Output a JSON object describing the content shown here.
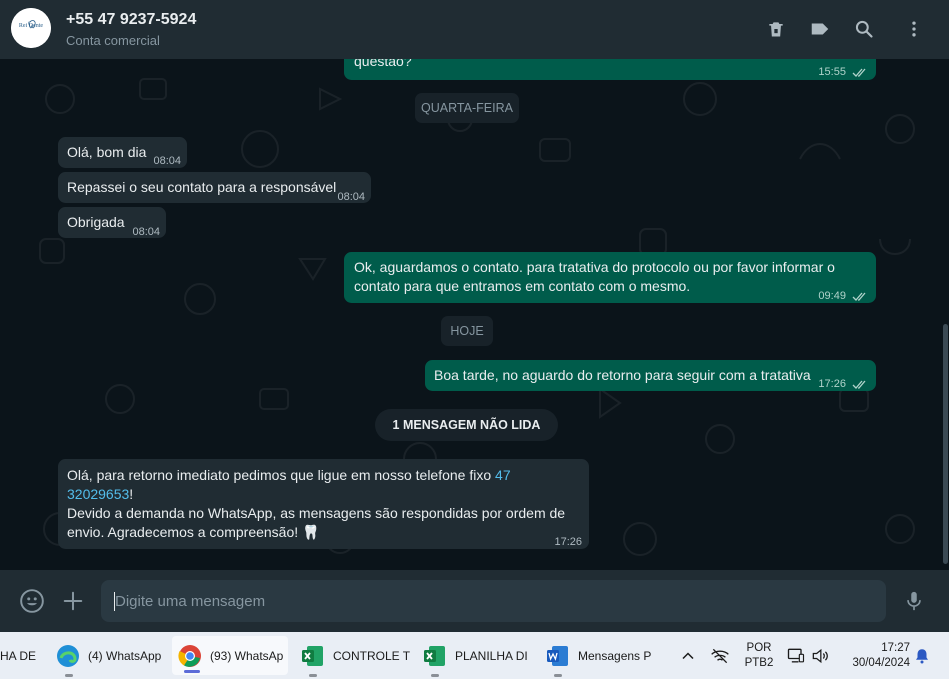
{
  "header": {
    "avatar_text": "Rei Dente",
    "contact_name": "+55 47 9237-5924",
    "contact_sub": "Conta comercial",
    "icons": [
      "delete-icon",
      "label-icon",
      "search-icon",
      "menu-icon"
    ]
  },
  "messages": [
    {
      "dir": "out",
      "text": "questão?",
      "time": "15:55"
    },
    {
      "dir": "pill",
      "text": "QUARTA-FEIRA"
    },
    {
      "dir": "in",
      "text": "Olá, bom dia",
      "time": "08:04"
    },
    {
      "dir": "in",
      "text": "Repassei o seu contato para a responsável",
      "time": "08:04"
    },
    {
      "dir": "in",
      "text": "Obrigada",
      "time": "08:04"
    },
    {
      "dir": "out",
      "text1": "Ok, aguardamos o contato. para tratativa do protocolo ou por favor informar o",
      "text2": "contato para que entramos em contato com o mesmo.",
      "time": "09:49"
    },
    {
      "dir": "pill",
      "text": "HOJE"
    },
    {
      "dir": "out",
      "text": "Boa tarde, no aguardo do retorno para seguir com a tratativa",
      "time": "17:26"
    },
    {
      "dir": "unread",
      "text": "1 MENSAGEM NÃO LIDA"
    },
    {
      "dir": "in",
      "line1": "Olá, para retorno imediato pedimos que ligue em nosso telefone fixo ",
      "link1": "47",
      "link2": "32029653",
      "after_link": "!",
      "line3": "Devido a demanda no WhatsApp, as mensagens são respondidas por ordem de",
      "line4": "envio. Agradecemos a compreensão! 🦷",
      "time": "17:26"
    }
  ],
  "composer": {
    "placeholder": "Digite uma mensagem",
    "icons": [
      "emoji-icon",
      "attach-plus-icon",
      "microphone-icon"
    ]
  },
  "taskbar": {
    "items": [
      {
        "label": "HA DE"
      },
      {
        "label": "(4) WhatsApp"
      },
      {
        "label": "(93) WhatsAp"
      },
      {
        "label": "CONTROLE T"
      },
      {
        "label": "PLANILHA DI"
      },
      {
        "label": "Mensagens P"
      }
    ],
    "lang1": "POR",
    "lang2": "PTB2",
    "clock_time": "17:27",
    "clock_date": "30/04/2024"
  },
  "colors": {
    "outgoing": "#005c4b",
    "incoming": "#202c33",
    "background": "#0b141a",
    "link": "#53bdeb"
  }
}
